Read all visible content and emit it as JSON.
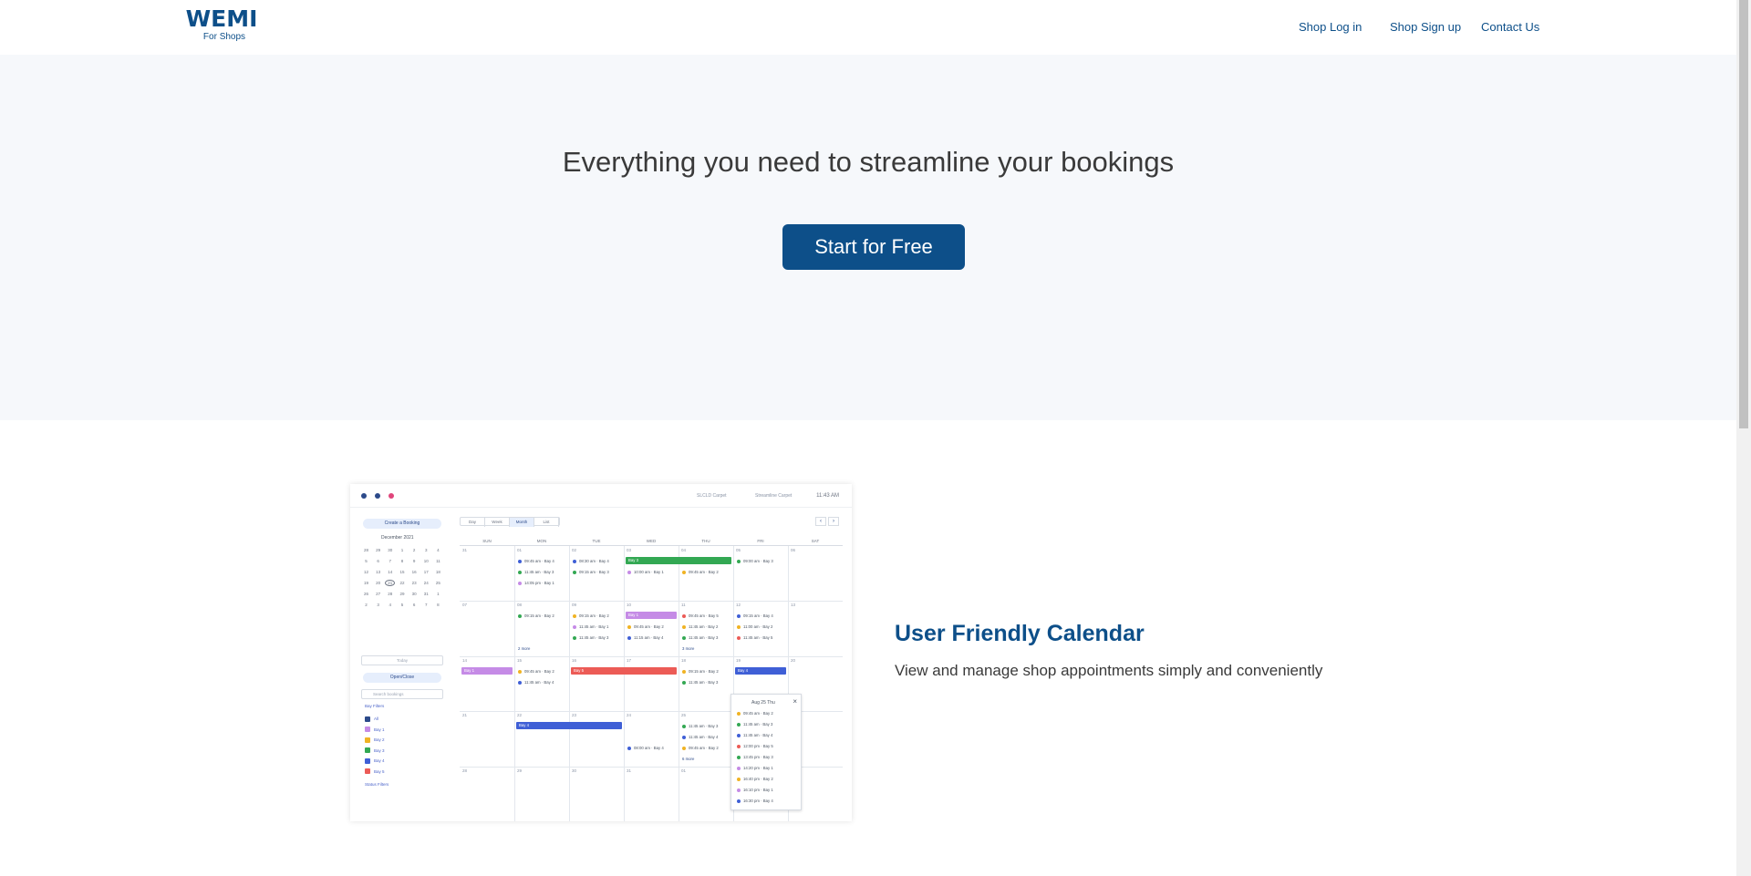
{
  "header": {
    "logo_main": "WEMI",
    "logo_sub": "For Shops",
    "nav": [
      "Shop Log in",
      "Shop Sign up",
      "Contact Us"
    ]
  },
  "hero": {
    "title": "Everything you need to streamline your bookings",
    "cta": "Start for Free"
  },
  "feature": {
    "title": "User Friendly Calendar",
    "description": "View and manage shop appointments simply and conveniently"
  },
  "colors": {
    "brand": "#0d4f89",
    "hero_bg": "#f6f8fb",
    "text": "#3a3a3a"
  },
  "calendar_preview": {
    "top_links": [
      "SLCLD Carpet",
      "Streamline Carpet"
    ],
    "time": "11:43 AM",
    "create_button": "Create a Booking",
    "month_label": "December   2021",
    "today_button": "Today",
    "open_close": "Open/Close",
    "search_placeholder": "Search bookings",
    "bay_filters_label": "Bay Filters",
    "bay_filters": [
      "All",
      "Bay 1",
      "Bay 2",
      "Bay 3",
      "Bay 4",
      "Bay 5"
    ],
    "status_filters_label": "Status Filters",
    "views": [
      "Day",
      "Week",
      "Month",
      "List"
    ],
    "active_view": "Month",
    "weekdays": [
      "SUN",
      "MON",
      "TUE",
      "WED",
      "THU",
      "FRI",
      "SAT"
    ],
    "popup_title": "Aug 25  Thu"
  }
}
